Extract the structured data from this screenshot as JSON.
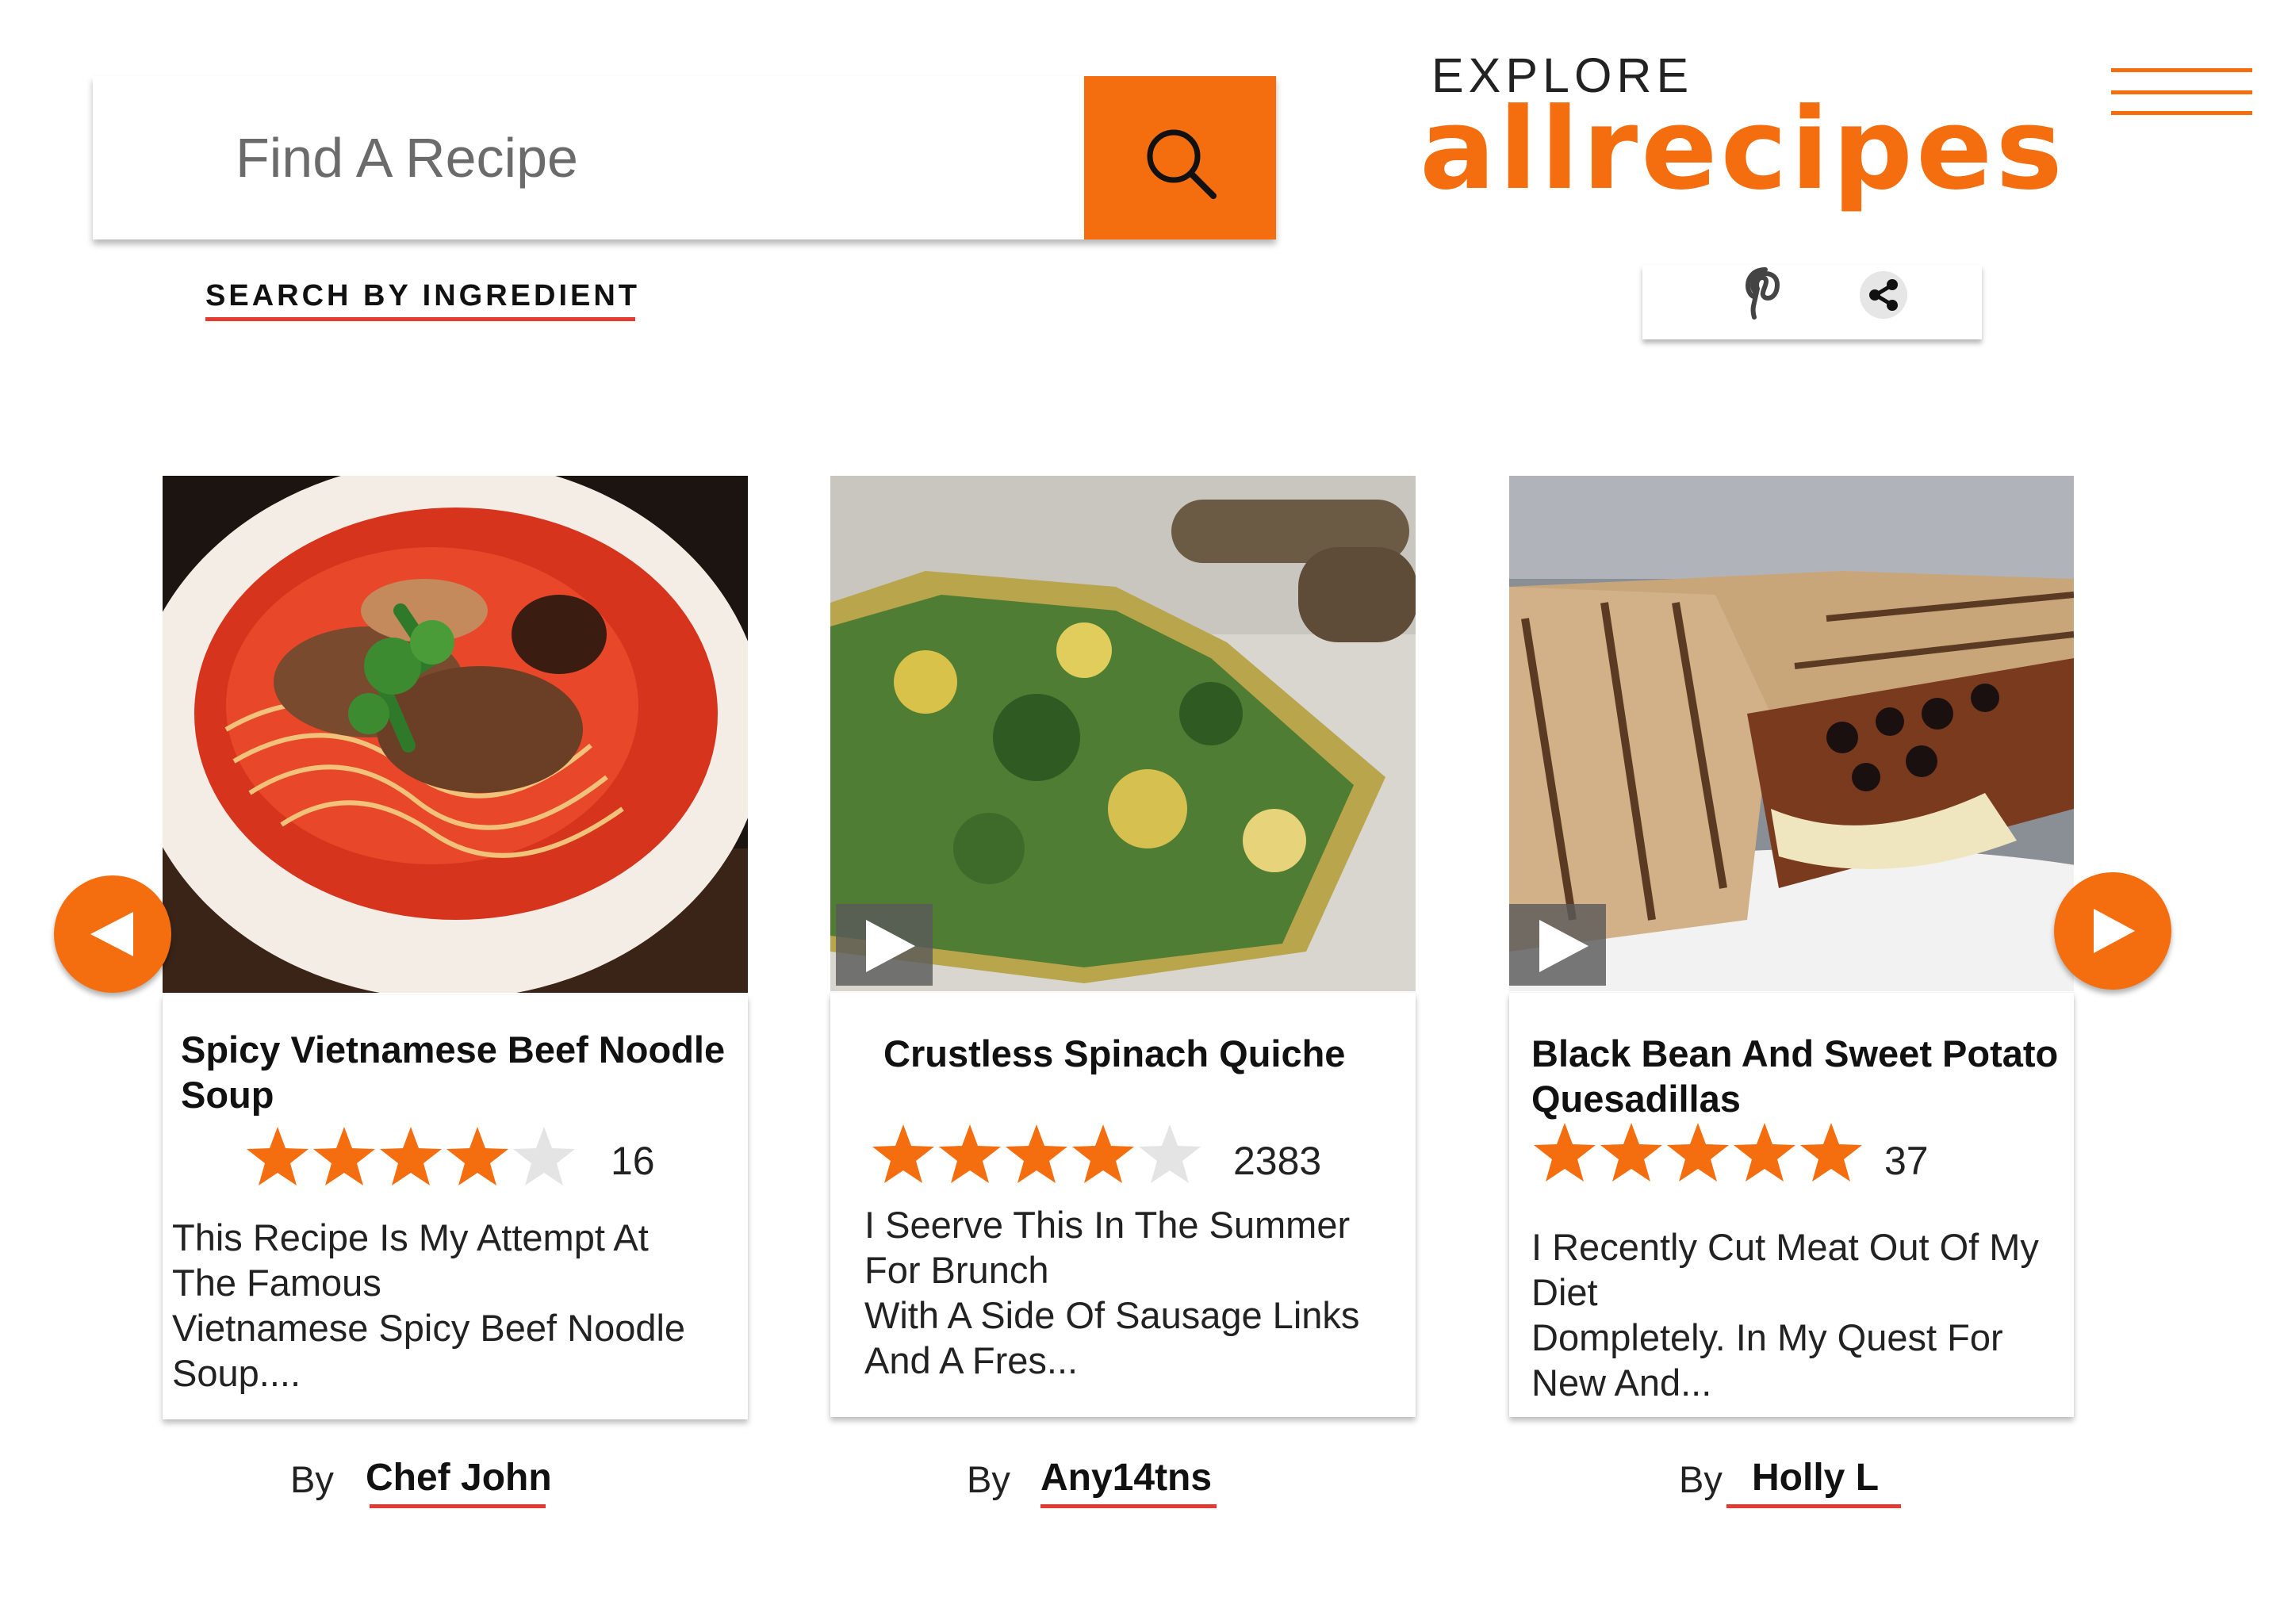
{
  "search": {
    "placeholder": "Find A Recipe",
    "button_icon": "search-icon",
    "ingredient_link": "SEARCH BY INGREDIENT"
  },
  "brand": {
    "explore_label": "EXPLORE",
    "logo_text": "allrecipes",
    "accent_color": "#f46e0f",
    "underline_color": "#e43a2f"
  },
  "share": {
    "icons": [
      "pinterest-icon",
      "share-icon"
    ]
  },
  "menu": {
    "icon": "hamburger-icon"
  },
  "carousel": {
    "prev_icon": "chevron-left-icon",
    "next_icon": "chevron-right-icon",
    "recipes": [
      {
        "title": "Spicy Vietnamese Beef Noodle Soup",
        "rating": 4,
        "rating_max": 5,
        "rating_count": "16",
        "description_lines": [
          "This Recipe Is My Attempt At",
          "The Famous",
          "Vietnamese Spicy Beef Noodle",
          "Soup...."
        ],
        "by_label": "By",
        "author": "Chef John",
        "has_video": false,
        "image": "bowl of red spicy beef noodle soup with cilantro"
      },
      {
        "title": "Crustless Spinach Quiche",
        "rating": 4,
        "rating_max": 5,
        "rating_count": "2383",
        "description_lines": [
          "I Seerve This In The Summer",
          "For Brunch",
          "With A Side Of Sausage Links",
          "And A Fres..."
        ],
        "by_label": "By",
        "author": "Any14tns",
        "has_video": true,
        "image": "slice of spinach quiche with sausage links"
      },
      {
        "title": "Black Bean And Sweet Potato Quesadillas",
        "rating": 5,
        "rating_max": 5,
        "rating_count": "37",
        "description_lines": [
          "I Recently Cut Meat Out Of My",
          "Diet",
          "Dompletely. In My Quest For",
          "New And..."
        ],
        "by_label": "By",
        "author": "Holly L",
        "has_video": true,
        "image": "grilled black bean and sweet potato quesadillas"
      }
    ]
  }
}
